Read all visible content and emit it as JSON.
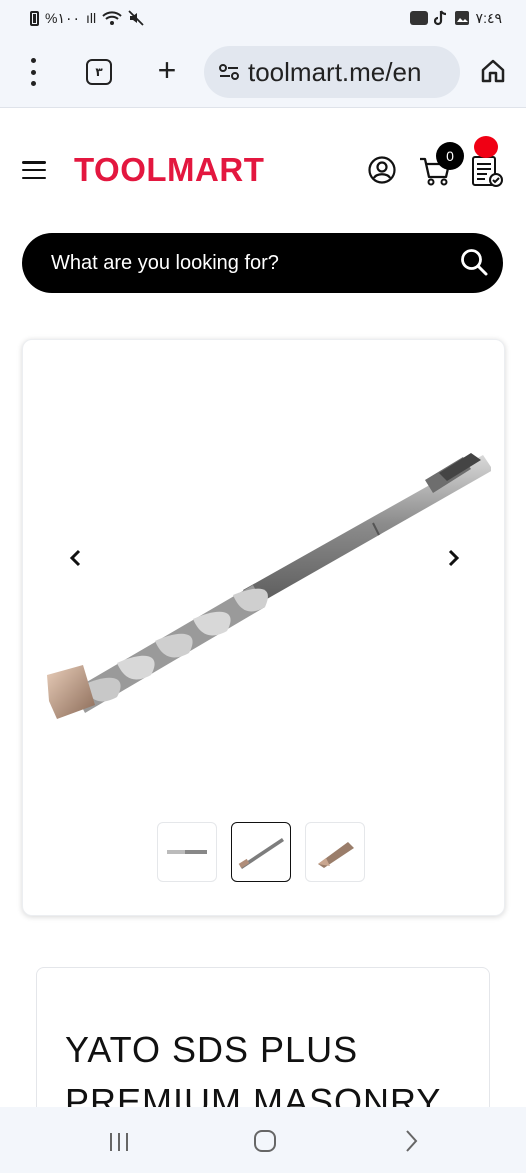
{
  "status_bar": {
    "battery_text": "%١٠٠",
    "signal_text": "ıll",
    "time": "٧:٤٩"
  },
  "browser": {
    "tab_count": "٣",
    "url": "toolmart.me/en"
  },
  "header": {
    "logo": "TOOLMART",
    "cart_count": "0"
  },
  "search": {
    "placeholder": "What are you looking for?"
  },
  "product": {
    "title": "YATO SDS PLUS PREMIUM MASONRY"
  },
  "colors": {
    "brand": "#e3173f",
    "search_bg": "#000000",
    "notif": "#f00014"
  },
  "icons": [
    "menu-dots-icon",
    "tabs-icon",
    "plus-icon",
    "site-settings-icon",
    "home-icon",
    "hamburger-icon",
    "account-icon",
    "cart-icon",
    "checklist-icon",
    "search-icon",
    "chevron-left-icon",
    "chevron-right-icon"
  ]
}
